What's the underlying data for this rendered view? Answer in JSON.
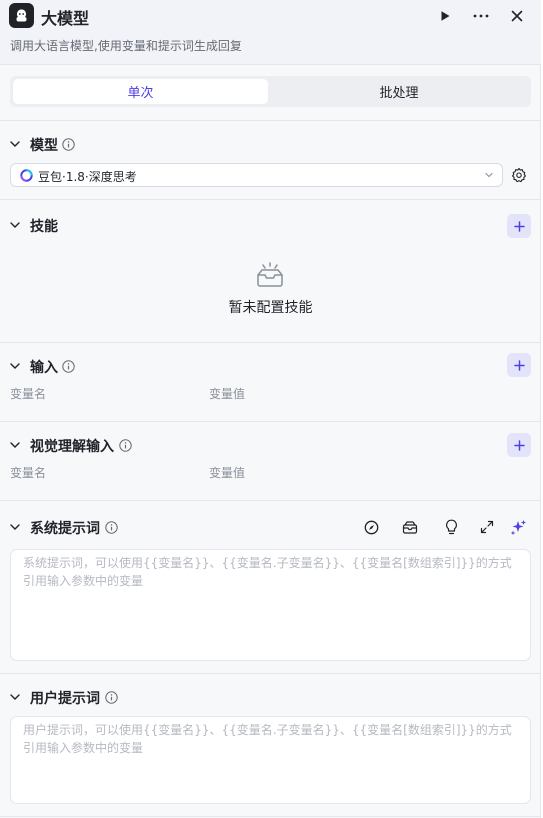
{
  "header": {
    "title": "大模型",
    "subtitle": "调用大语言模型,使用变量和提示词生成回复",
    "icons": {
      "logo": "assistant-logo-icon",
      "run": "play-icon",
      "more": "more-icon",
      "close": "close-icon"
    }
  },
  "tabs": [
    {
      "label": "单次",
      "active": true
    },
    {
      "label": "批处理",
      "active": false
    }
  ],
  "model_section": {
    "title": "模型",
    "selected_model": "豆包·1.8·深度思考"
  },
  "skills_section": {
    "title": "技能",
    "empty_text": "暂未配置技能"
  },
  "input_section": {
    "title": "输入",
    "col_name": "变量名",
    "col_value": "变量值"
  },
  "visual_input_section": {
    "title": "视觉理解输入",
    "col_name": "变量名",
    "col_value": "变量值"
  },
  "system_prompt_section": {
    "title": "系统提示词",
    "placeholder": "系统提示词，可以使用{{变量名}}、{{变量名.子变量名}}、{{变量名[数组索引]}}的方式引用输入参数中的变量",
    "tools": [
      "compass-icon",
      "library-icon",
      "lightbulb-icon",
      "expand-icon",
      "sparkle-icon"
    ]
  },
  "user_prompt_section": {
    "title": "用户提示词",
    "placeholder": "用户提示词，可以使用{{变量名}}、{{变量名.子变量名}}、{{变量名[数组索引]}}的方式引用输入参数中的变量"
  },
  "colors": {
    "accent": "#4e40e5",
    "add_button_bg": "#e3e3fa",
    "panel_bg": "#f7f8fa",
    "header_bg": "#f2f3f8"
  }
}
